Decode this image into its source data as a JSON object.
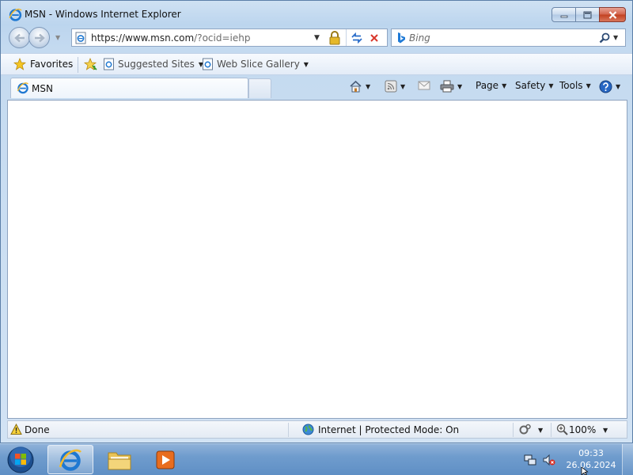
{
  "window": {
    "title": "MSN - Windows Internet Explorer",
    "caption_icons": [
      "minimize-icon",
      "maximize-icon",
      "close-icon"
    ]
  },
  "address_bar": {
    "url_prefix": "https://www.",
    "url_domain": "msn.com",
    "url_suffix": "/?ocid=iehp",
    "icons": [
      "page-icon",
      "lock-icon",
      "refresh-icon",
      "stop-icon"
    ]
  },
  "search": {
    "placeholder": "Bing",
    "icon": "bing-icon"
  },
  "favorites_bar": {
    "favorites_label": "Favorites",
    "links": [
      {
        "label": "Suggested Sites"
      },
      {
        "label": "Web Slice Gallery"
      }
    ]
  },
  "tabs": [
    {
      "label": "MSN",
      "active": true
    }
  ],
  "command_bar": {
    "page_label": "Page",
    "safety_label": "Safety",
    "tools_label": "Tools",
    "icons": [
      "home-icon",
      "feeds-icon",
      "read-mail-icon",
      "print-icon",
      "help-icon"
    ]
  },
  "status_bar": {
    "status": "Done",
    "zone": "Internet | Protected Mode: On",
    "zoom": "100%"
  },
  "taskbar": {
    "items": [
      "internet-explorer",
      "windows-explorer",
      "media-player"
    ],
    "time": "09:33",
    "date": "26.06.2024"
  },
  "colors": {
    "window_frame": "#c4daf0",
    "taskbar": "#6f9ccd",
    "content_bg": "#ffffff",
    "close_button": "#c2401f"
  }
}
